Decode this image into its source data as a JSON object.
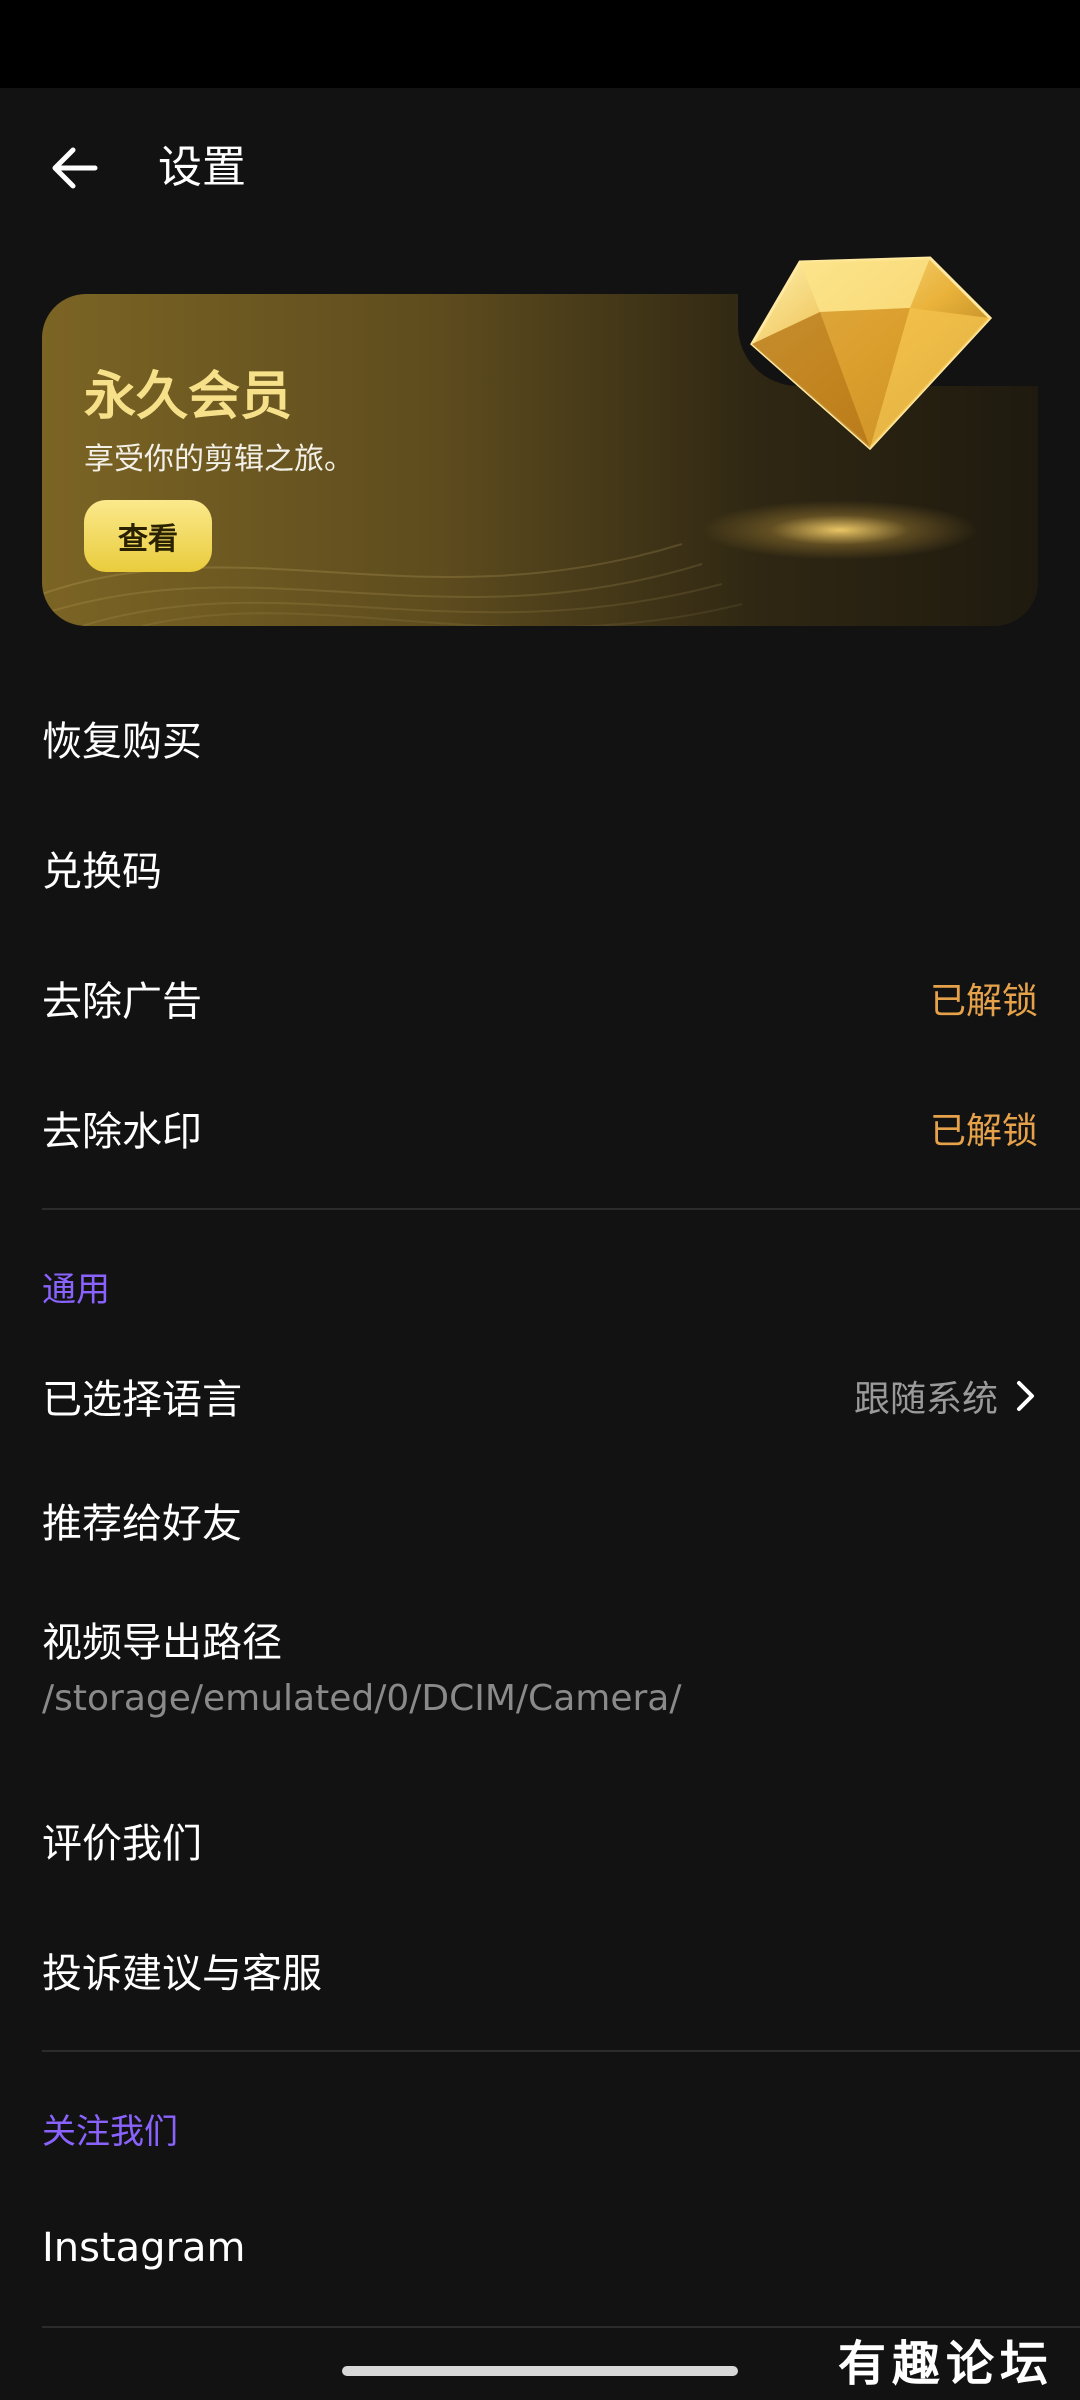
{
  "header": {
    "title": "设置",
    "back_icon": "arrow-left-icon"
  },
  "vip_card": {
    "title": "永久会员",
    "subtitle": "享受你的剪辑之旅。",
    "button_label": "查看",
    "gem_icon": "diamond-icon",
    "accent_color": "#f7e08a"
  },
  "purchases": [
    {
      "label": "恢复购买",
      "value": ""
    },
    {
      "label": "兑换码",
      "value": ""
    },
    {
      "label": "去除广告",
      "value": "已解锁"
    },
    {
      "label": "去除水印",
      "value": "已解锁"
    }
  ],
  "general": {
    "title": "通用",
    "language": {
      "label": "已选择语言",
      "value": "跟随系统",
      "icon": "chevron-right-icon"
    },
    "recommend": {
      "label": "推荐给好友"
    },
    "export_path": {
      "label": "视频导出路径",
      "path": "/storage/emulated/0/DCIM/Camera/"
    },
    "rate": {
      "label": "评价我们"
    },
    "feedback": {
      "label": "投诉建议与客服"
    }
  },
  "follow": {
    "title": "关注我们",
    "instagram": "Instagram"
  },
  "watermark": "有趣论坛",
  "colors": {
    "background": "#121212",
    "section_accent": "#8a63ff",
    "unlocked": "#e6a24a"
  }
}
